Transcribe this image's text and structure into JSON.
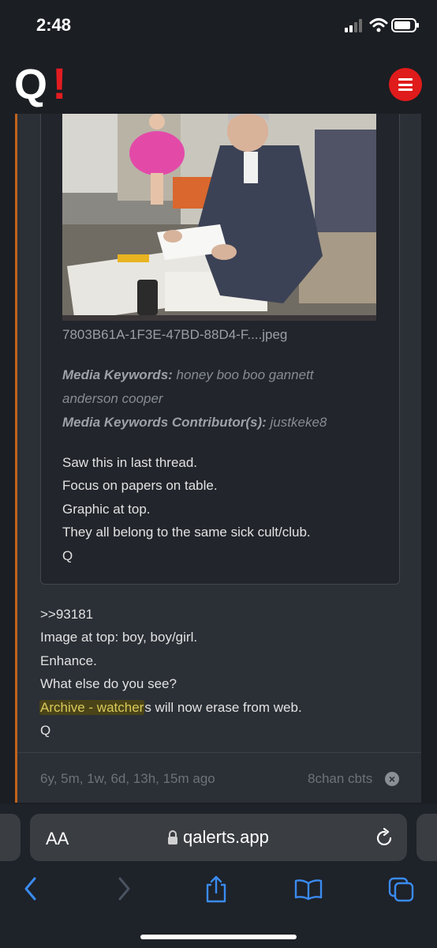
{
  "status_bar": {
    "time": "2:48"
  },
  "header": {
    "logo_letter": "Q",
    "logo_mark": "!"
  },
  "quoted_post": {
    "filename": "7803B61A-1F3E-47BD-88D4-F....jpeg",
    "media_keywords_label": "Media Keywords:",
    "media_keywords_value_1": "honey boo boo gannett",
    "media_keywords_value_2": "anderson cooper",
    "contributors_label": "Media Keywords Contributor(s):",
    "contributors_value": "justkeke8",
    "lines": [
      "Saw this in last thread.",
      "Focus on papers on table.",
      "Graphic at top.",
      "They all belong to the same sick cult/club.",
      "Q"
    ]
  },
  "post": {
    "lines": [
      ">>93181",
      "Image at top: boy, boy/girl.",
      "Enhance.",
      "What else do you see?"
    ],
    "highlight_text": "Archive - watcher",
    "after_highlight": "s will now erase from web.",
    "signature": "Q"
  },
  "footer": {
    "time_ago": "6y, 5m, 1w, 6d, 13h, 15m ago",
    "source": "8chan cbts"
  },
  "browser": {
    "text_size_label": "AA",
    "url": "qalerts.app"
  },
  "colors": {
    "accent_orange": "#c0631b",
    "brand_red": "#e21c21",
    "highlight": "#d9c95a"
  }
}
